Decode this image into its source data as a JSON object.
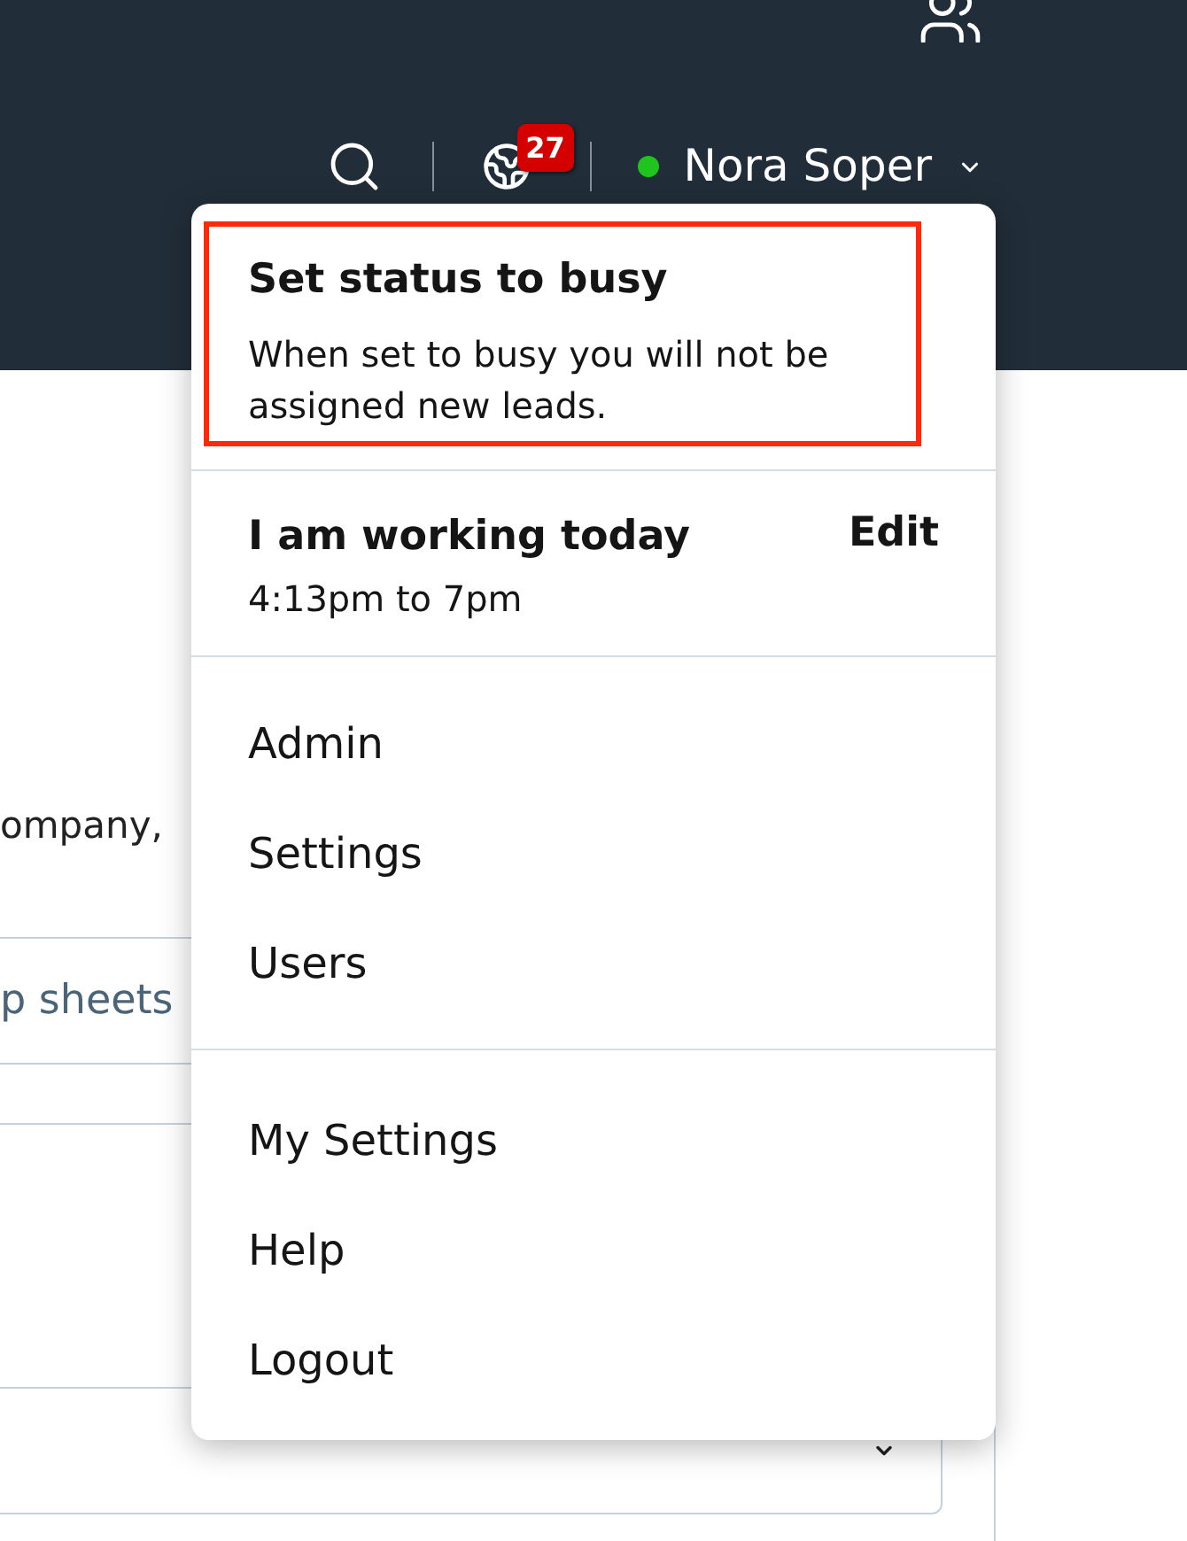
{
  "header": {
    "user_name": "Nora Soper",
    "online": true,
    "notification_count": "27"
  },
  "page": {
    "text_fragment": "ompany,",
    "button_label": "p sheets"
  },
  "menu": {
    "status_option": {
      "title": "Set status to busy",
      "description": "When set to busy you will not be assigned new leads.",
      "highlighted": true
    },
    "schedule": {
      "title": "I am working today",
      "hours": "4:13pm to 7pm",
      "action": "Edit"
    },
    "sections": [
      {
        "items": [
          "Admin",
          "Settings",
          "Users"
        ]
      },
      {
        "items": [
          "My Settings",
          "Help",
          "Logout"
        ]
      }
    ]
  }
}
